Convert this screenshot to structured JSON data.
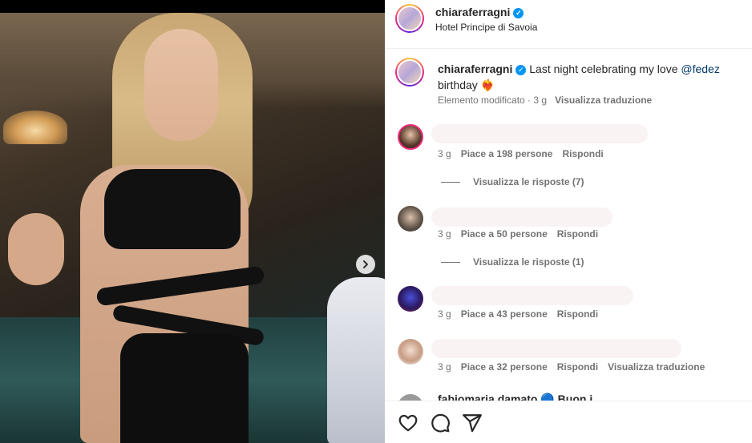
{
  "header": {
    "username": "chiaraferragni",
    "location": "Hotel Principe di Savoia"
  },
  "caption": {
    "username": "chiaraferragni",
    "text_before": " Last night celebrating my love ",
    "mention": "@fedez",
    "text_after": " birthday ❤️‍🔥",
    "meta": "Elemento modificato · 3 g",
    "translate": "Visualizza traduzione"
  },
  "comments": [
    {
      "time": "3 g",
      "likes": "Piace a 198 persone",
      "reply": "Rispondi",
      "view_replies": "Visualizza le risposte (7)"
    },
    {
      "time": "3 g",
      "likes": "Piace a 50 persone",
      "reply": "Rispondi",
      "view_replies": "Visualizza le risposte (1)"
    },
    {
      "time": "3 g",
      "likes": "Piace a 43 persone",
      "reply": "Rispondi"
    },
    {
      "time": "3 g",
      "likes": "Piace a 32 persone",
      "reply": "Rispondi",
      "translate": "Visualizza traduzione"
    }
  ],
  "partial_comment": "fabiomaria damato 🔵 Buon i...",
  "icons": {
    "next": "chevron-right-icon",
    "like": "heart-icon",
    "comment": "comment-icon",
    "share": "paper-plane-icon",
    "verified": "verified-badge-icon"
  },
  "colors": {
    "verified": "#0095f6",
    "mention": "#00376b",
    "meta_text": "#737373"
  }
}
